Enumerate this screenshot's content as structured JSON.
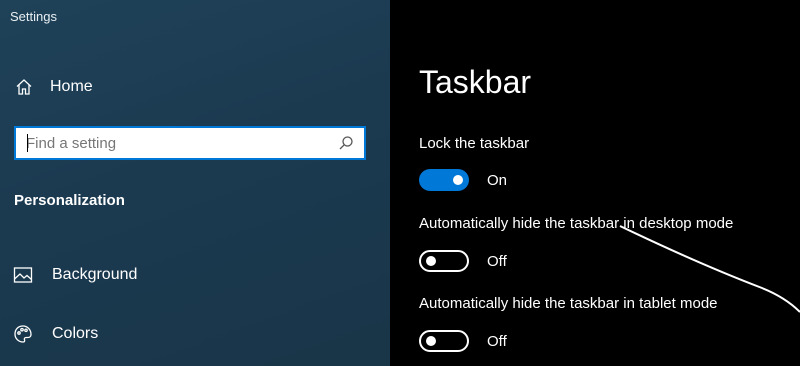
{
  "window": {
    "title": "Settings"
  },
  "sidebar": {
    "home_label": "Home",
    "search": {
      "placeholder": "Find a setting",
      "value": ""
    },
    "section_heading": "Personalization",
    "items": [
      {
        "label": "Background",
        "icon": "image-icon"
      },
      {
        "label": "Colors",
        "icon": "palette-icon"
      }
    ]
  },
  "main": {
    "title": "Taskbar",
    "settings": [
      {
        "label": "Lock the taskbar",
        "state": "On",
        "enabled": true
      },
      {
        "label": "Automatically hide the taskbar in desktop mode",
        "state": "Off",
        "enabled": false
      },
      {
        "label": "Automatically hide the taskbar in tablet mode",
        "state": "Off",
        "enabled": false
      }
    ]
  },
  "colors": {
    "accent": "#0078d7",
    "sidebar_bg": "#1d3d53",
    "main_bg": "#000000"
  }
}
